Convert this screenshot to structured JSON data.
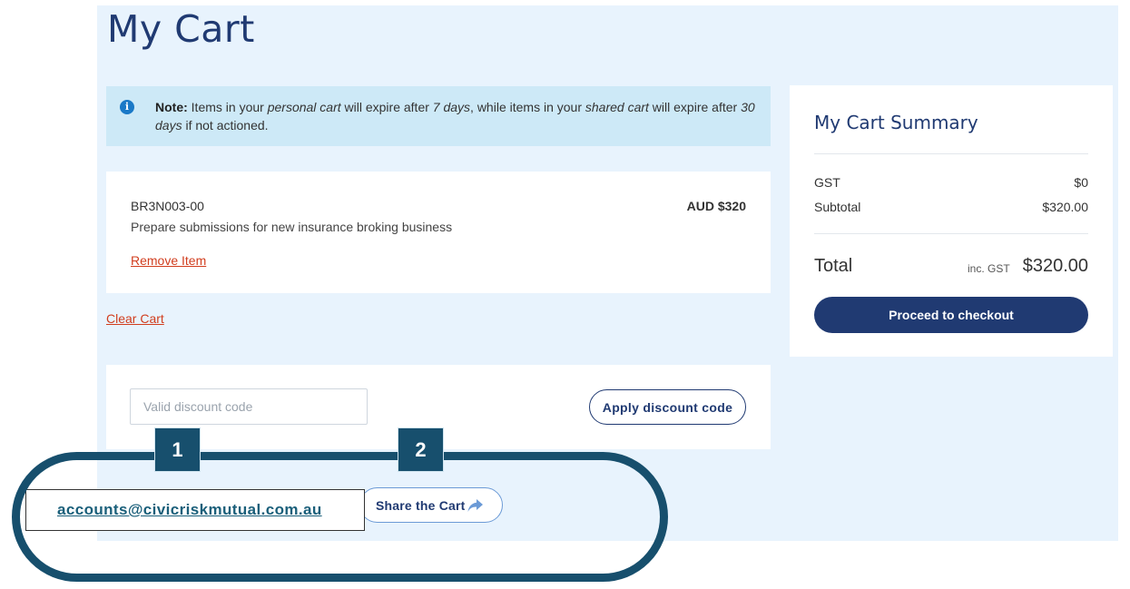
{
  "page": {
    "title": "My Cart"
  },
  "note": {
    "label": "Note:",
    "text_parts": [
      " Items in your ",
      "personal cart",
      " will expire after ",
      "7 days",
      ", while items in your ",
      "shared cart",
      " will expire after ",
      "30 days",
      " if not actioned."
    ]
  },
  "cart": {
    "items": [
      {
        "code": "BR3N003-00",
        "price": "AUD $320",
        "description": "Prepare submissions for new insurance broking business",
        "remove_label": "Remove Item"
      }
    ],
    "clear_label": "Clear Cart"
  },
  "discount": {
    "placeholder": "Valid discount code",
    "apply_label": "Apply discount code"
  },
  "summary": {
    "title": "My Cart Summary",
    "gst_label": "GST",
    "gst_value": "$0",
    "subtotal_label": "Subtotal",
    "subtotal_value": "$320.00",
    "total_label": "Total",
    "total_inc": "inc. GST",
    "total_value": "$320.00",
    "checkout_label": "Proceed to checkout"
  },
  "share": {
    "label": "Share the Cart",
    "icon": "share-arrow-icon"
  },
  "annotation": {
    "email": "accounts@civicriskmutual.com.au",
    "marker_1": "1",
    "marker_2": "2",
    "color": "#174f6d"
  },
  "colors": {
    "brand_navy": "#203a72",
    "link_red": "#d13d1e",
    "page_bg": "#e8f3fd",
    "note_bg": "#cde9f7"
  }
}
